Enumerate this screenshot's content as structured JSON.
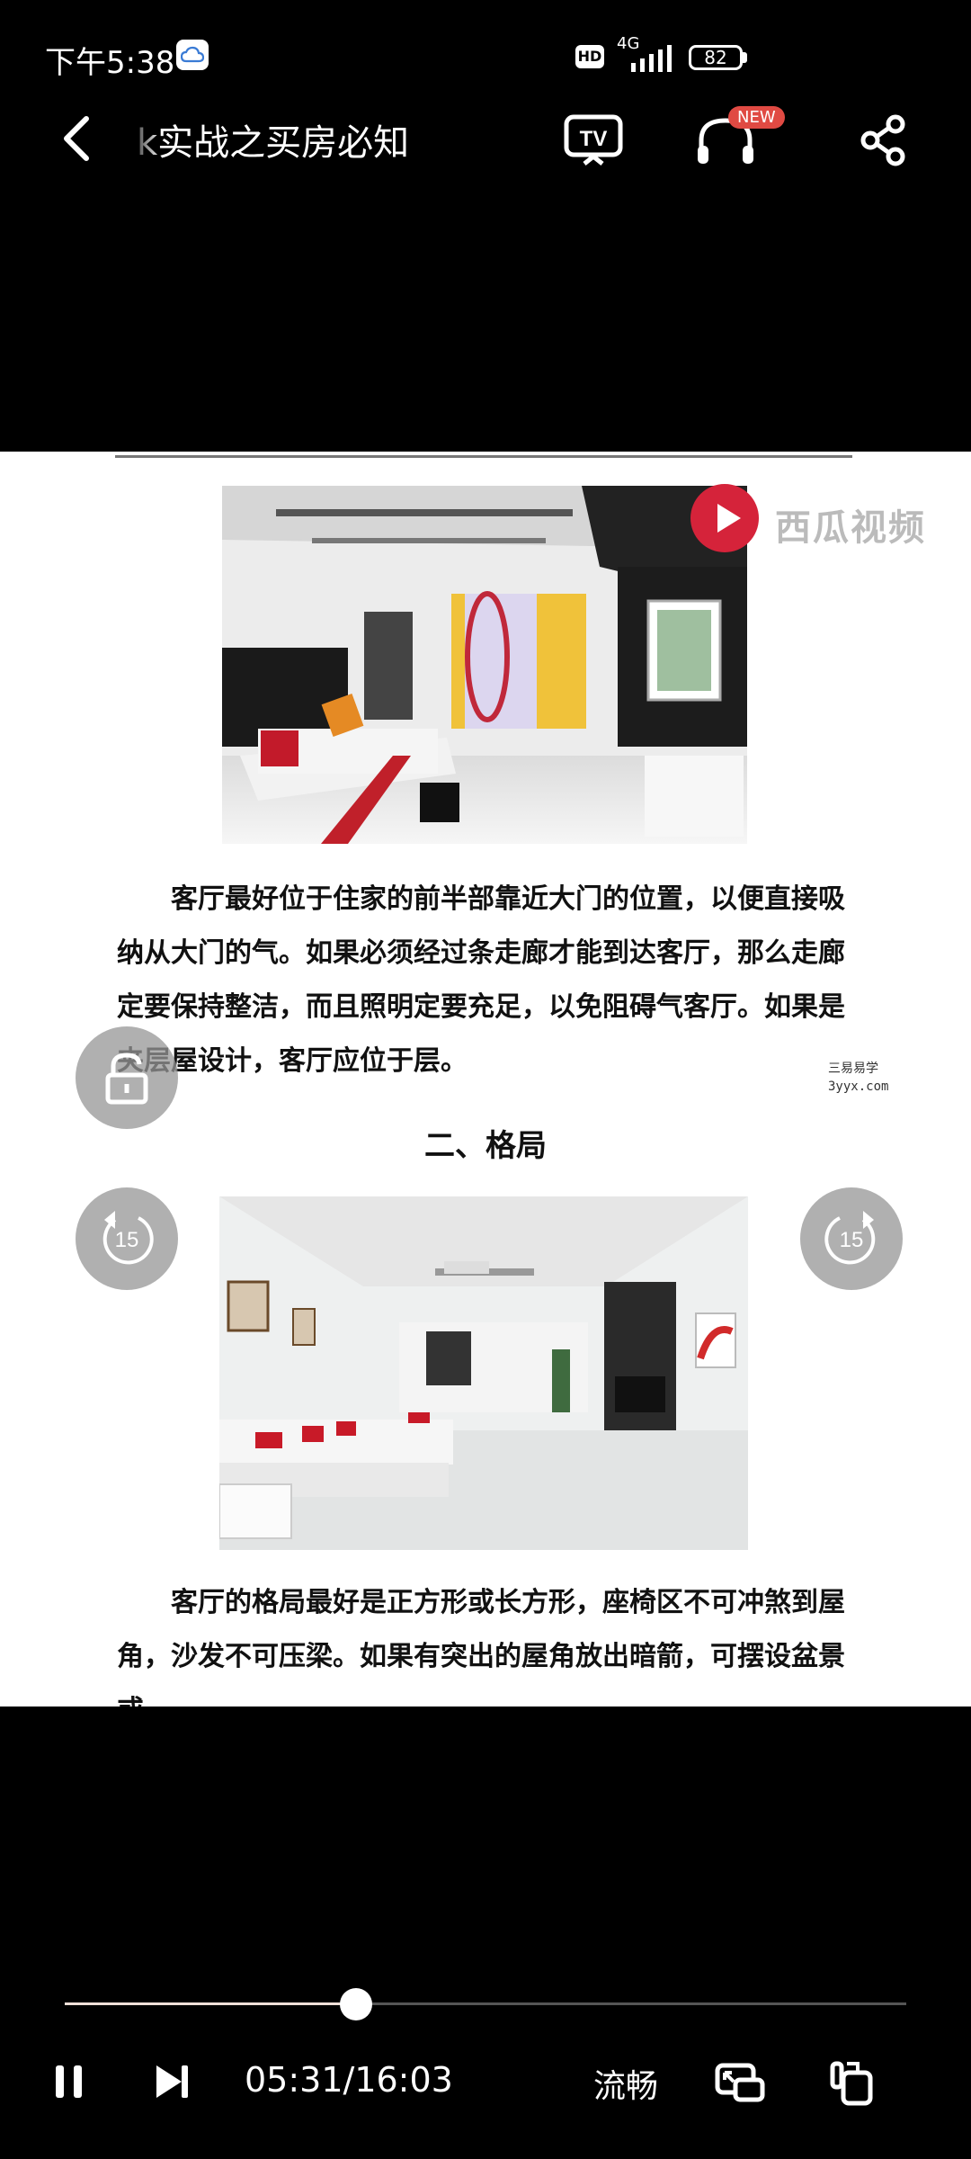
{
  "status_bar": {
    "time": "下午5:38",
    "cloud_icon": "cloud-icon",
    "hd_label": "HD",
    "network": "4G",
    "battery": "82"
  },
  "top_bar": {
    "title": "k实战之买房必知",
    "new_badge": "NEW",
    "icons": [
      "back-arrow-icon",
      "tv-cast-icon",
      "headphone-icon",
      "share-icon"
    ]
  },
  "video": {
    "watermark": "西瓜视频",
    "site_mark_line1": "三易易学",
    "site_mark_line2": "3yyx.com",
    "paragraph1": "客厅最好位于住家的前半部靠近大门的位置，以便直接吸纳从大门的气。如果必须经过条走廊才能到达客厅，那么走廊定要保持整洁，而且照明定要充足，以免阻碍气客厅。如果是夹层屋设计，客厅应位于层。",
    "heading2": "二、格局",
    "paragraph2": "客厅的格局最好是正方形或长方形，座椅区不可冲煞到屋角，沙发不可压梁。如果有突出的屋角放出暗箭，可摆设盆景或",
    "overlay_icons": [
      "lock-icon",
      "rewind-15-icon",
      "forward-15-icon"
    ],
    "skip_seconds": "15"
  },
  "player": {
    "progress": 0.346,
    "time_display": "05:31/16:03",
    "quality": "流畅",
    "icons": [
      "pause-icon",
      "next-icon",
      "picture-in-picture-icon",
      "rotate-screen-icon"
    ]
  }
}
